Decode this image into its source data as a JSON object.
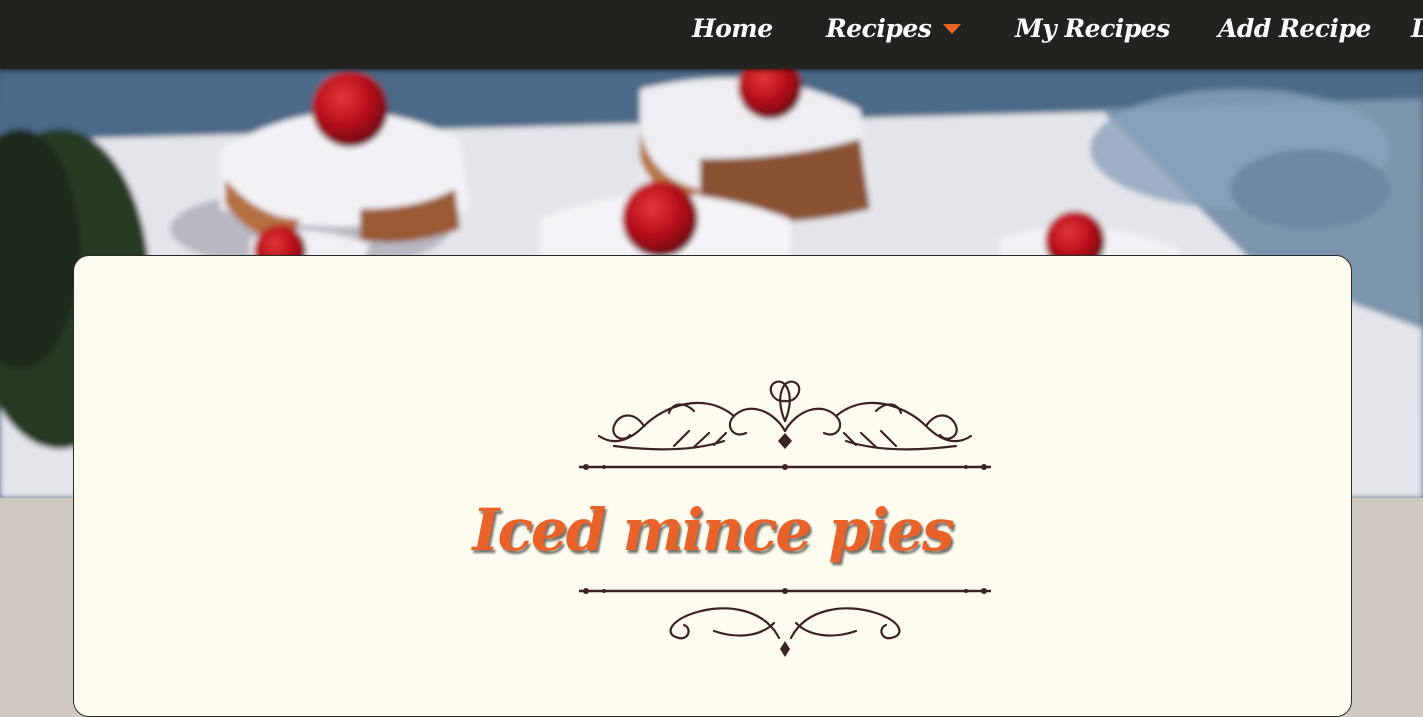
{
  "nav": {
    "items": [
      {
        "label": "Home"
      },
      {
        "label": "Recipes",
        "has_dropdown": true
      },
      {
        "label": "My Recipes"
      },
      {
        "label": "Add Recipe"
      },
      {
        "label": "L"
      }
    ],
    "accent_color": "#e8622a"
  },
  "recipe": {
    "title": "Iced mince pies"
  },
  "colors": {
    "navbar_bg": "#22221f",
    "card_bg": "#fefcee",
    "title": "#e8622a",
    "page_bg": "#cfc9bf"
  }
}
